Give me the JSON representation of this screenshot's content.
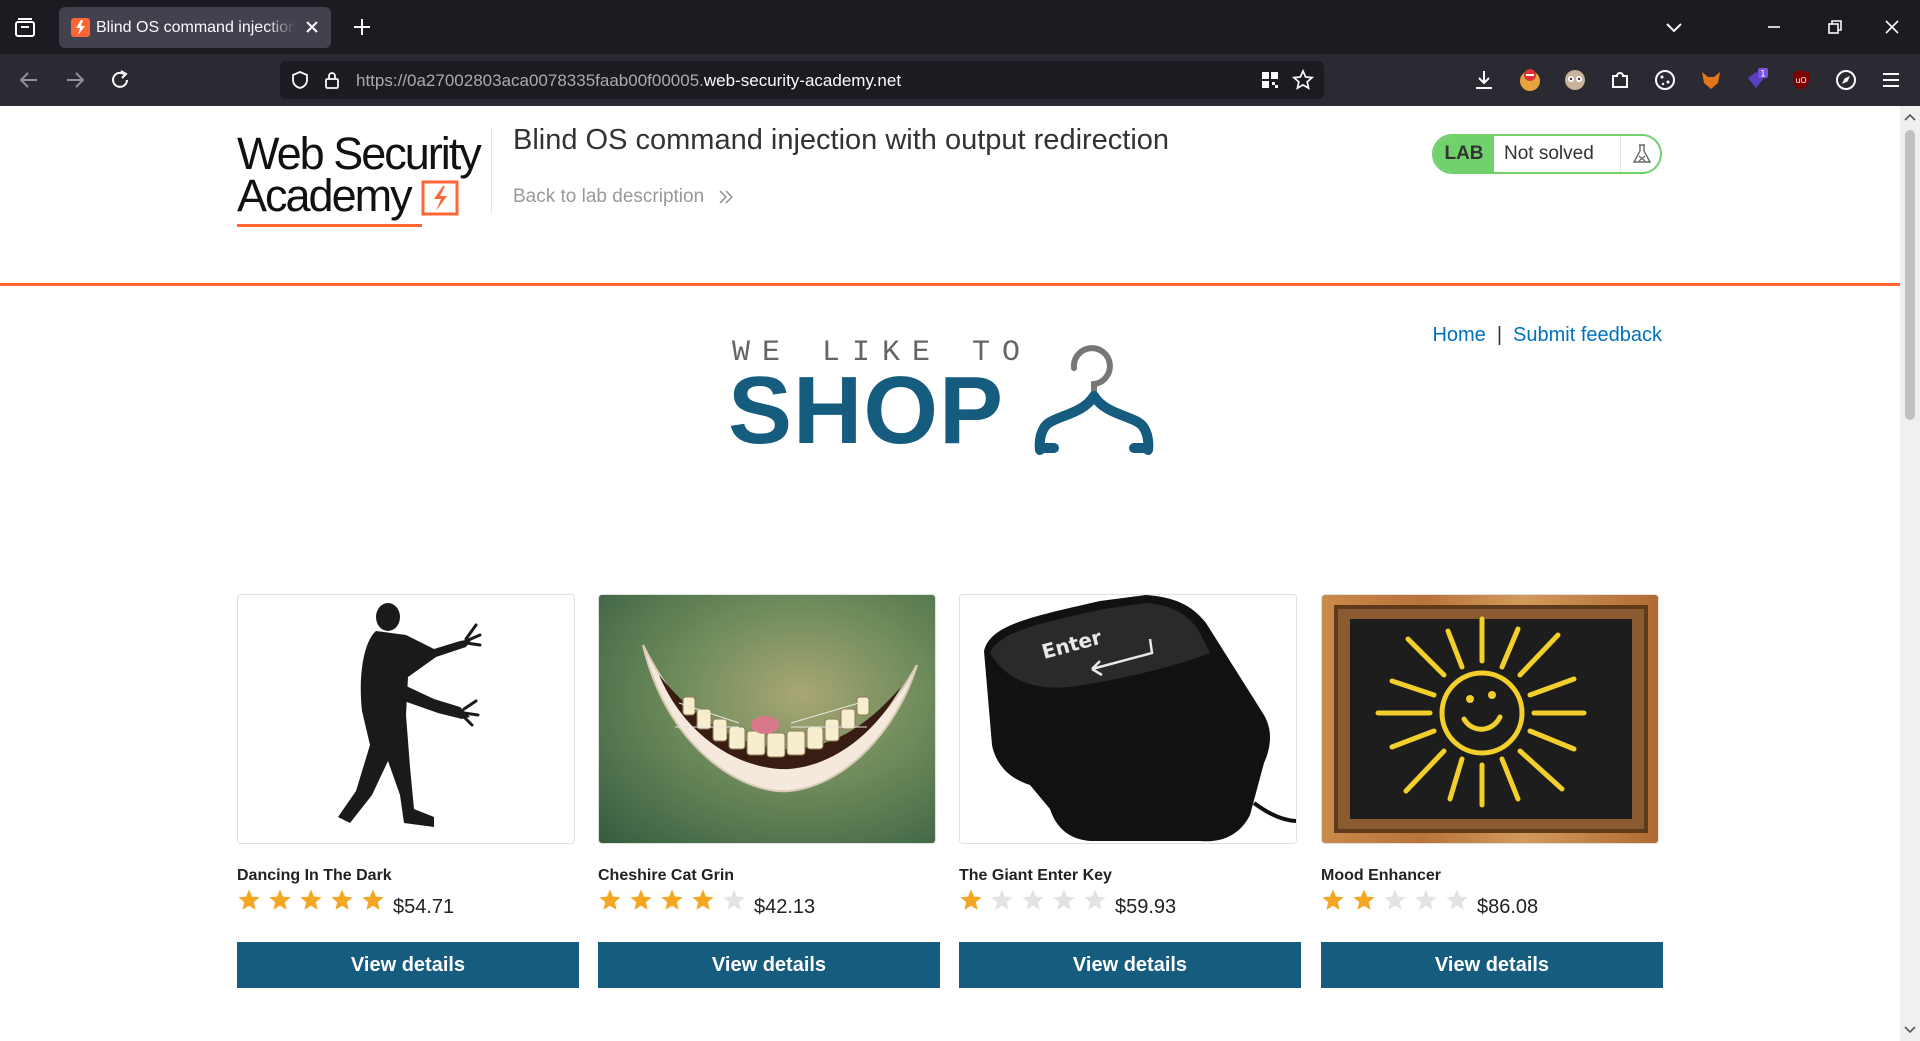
{
  "browser": {
    "tab": {
      "title": "Blind OS command injection with output redirection"
    },
    "url": {
      "prefix": "https://0a27002803aca0078335faab00f00005.",
      "domain": "web-security-academy.net"
    }
  },
  "lab": {
    "logo_line1": "Web Security",
    "logo_line2": "Academy",
    "title": "Blind OS command injection with output redirection",
    "back_link": "Back to lab description",
    "badge": "LAB",
    "status": "Not solved"
  },
  "nav": {
    "home": "Home",
    "separator": "|",
    "feedback": "Submit feedback"
  },
  "banner": {
    "small": "WE LIKE TO",
    "big": "SHOP"
  },
  "products": [
    {
      "name": "Dancing In The Dark",
      "rating": 5,
      "price": "$54.71",
      "button": "View details"
    },
    {
      "name": "Cheshire Cat Grin",
      "rating": 4,
      "price": "$42.13",
      "button": "View details"
    },
    {
      "name": "The Giant Enter Key",
      "rating": 1,
      "price": "$59.93",
      "button": "View details"
    },
    {
      "name": "Mood Enhancer",
      "rating": 2,
      "price": "$86.08",
      "button": "View details"
    }
  ],
  "colors": {
    "accent": "#ff6633",
    "brand": "#155c7f",
    "link": "#0071bc",
    "lab_green": "#70d16d",
    "star_on": "#f5a623",
    "star_off": "#e3e3e3"
  }
}
